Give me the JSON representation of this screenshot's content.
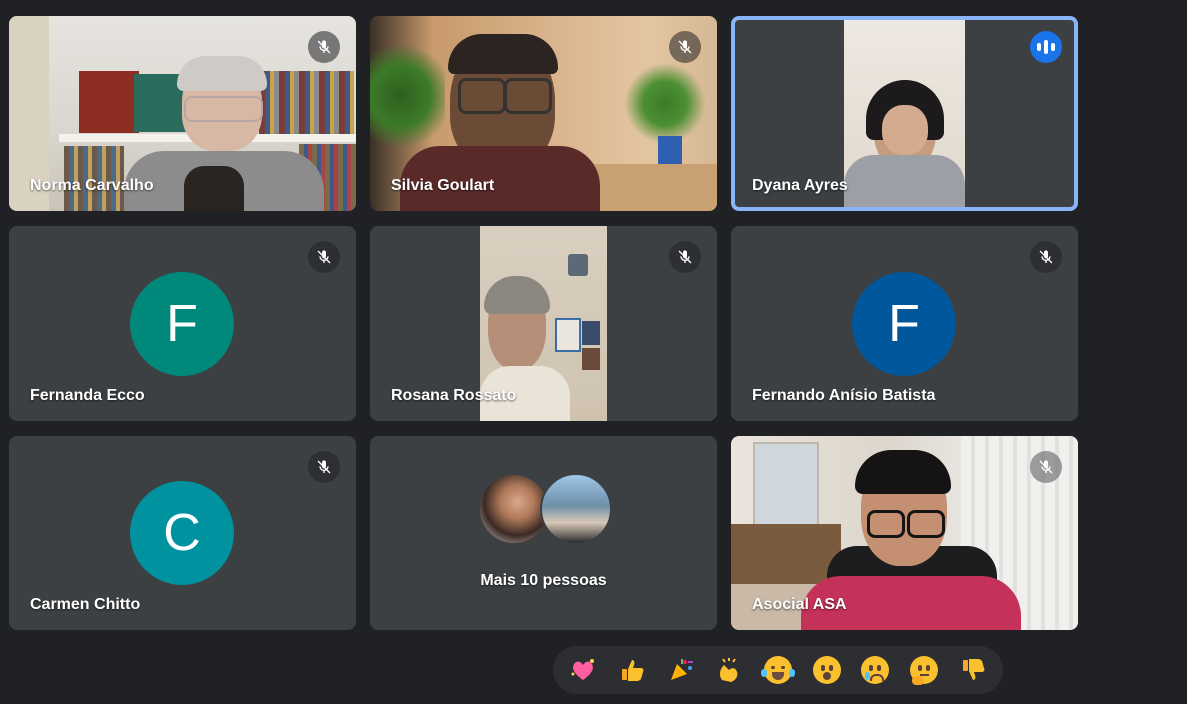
{
  "participants": [
    {
      "name": "Norma Carvalho"
    },
    {
      "name": "Silvia Goulart"
    },
    {
      "name": "Dyana Ayres"
    },
    {
      "name": "Fernanda Ecco",
      "initial": "F",
      "color": "#00897b"
    },
    {
      "name": "Rosana Rossato"
    },
    {
      "name": "Fernando Anísio Batista",
      "initial": "F",
      "color": "#01579b"
    },
    {
      "name": "Carmen Chitto",
      "initial": "C",
      "color": "#00929e"
    },
    {
      "name": "Asocial ASA"
    }
  ],
  "more": {
    "label": "Mais 10 pessoas"
  },
  "accent": "#8ab4f8",
  "reactions": [
    {
      "name": "sparkling-heart",
      "glyph": "💖"
    },
    {
      "name": "thumbs-up",
      "glyph": "👍"
    },
    {
      "name": "party-popper",
      "glyph": "🎉"
    },
    {
      "name": "clapping-hands",
      "glyph": "👏"
    },
    {
      "name": "tears-of-joy",
      "glyph": "😂"
    },
    {
      "name": "surprised",
      "glyph": "😮"
    },
    {
      "name": "crying",
      "glyph": "😢"
    },
    {
      "name": "thinking",
      "glyph": "🤔"
    },
    {
      "name": "thumbs-down",
      "glyph": "👎"
    }
  ]
}
